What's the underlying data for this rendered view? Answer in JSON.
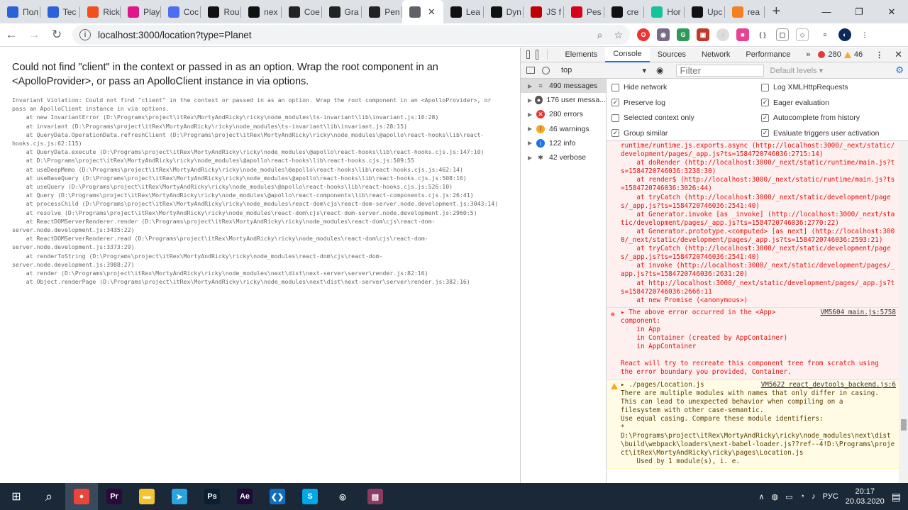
{
  "browser": {
    "tabs": [
      {
        "label": "Пол",
        "icon": "mail-icon",
        "color": "#2a62d8"
      },
      {
        "label": "Tec",
        "icon": "mail-icon",
        "color": "#2a62d8"
      },
      {
        "label": "Rick",
        "icon": "figma-icon",
        "color": "#f24e1e"
      },
      {
        "label": "Play",
        "icon": "figma-icon",
        "color": "#e0158a"
      },
      {
        "label": "Coc",
        "icon": "chat-icon",
        "color": "#4e6ef2"
      },
      {
        "label": "Rou",
        "icon": "next-icon",
        "color": "#111111"
      },
      {
        "label": "nex",
        "icon": "github-icon",
        "color": "#111111"
      },
      {
        "label": "Coe",
        "icon": "ch-icon",
        "color": "#222222"
      },
      {
        "label": "Gra",
        "icon": "ch-icon",
        "color": "#222222"
      },
      {
        "label": "Pen",
        "icon": "ch-icon",
        "color": "#222222"
      },
      {
        "label": "",
        "icon": "globe-icon",
        "color": "#5f6368",
        "active": true
      },
      {
        "label": "Lea",
        "icon": "next-icon",
        "color": "#111111"
      },
      {
        "label": "Dyn",
        "icon": "dev-icon",
        "color": "#111111"
      },
      {
        "label": "JS f",
        "icon": "heart-icon",
        "color": "#c00000"
      },
      {
        "label": "Pes",
        "icon": "hh-icon",
        "color": "#d6001c"
      },
      {
        "label": "cre",
        "icon": "github-icon",
        "color": "#111111"
      },
      {
        "label": "Hor",
        "icon": "grammarly-icon",
        "color": "#15c39a"
      },
      {
        "label": "Upc",
        "icon": "github-icon",
        "color": "#111111"
      },
      {
        "label": "rea",
        "icon": "stackoverflow-icon",
        "color": "#f48024"
      }
    ],
    "url": "localhost:3000/location?type=Planet"
  },
  "page": {
    "error_title": "Could not find \"client\" in the context or passed in as an option. Wrap the root component in an <ApolloProvider>, or pass an ApolloClient instance in via options.",
    "stack": "Invariant Violation: Could not find \"client\" in the context or passed in as an option. Wrap the root component in an <ApolloProvider>, or\npass an ApolloClient instance in via options.\n    at new InvariantError (D:\\Programs\\project\\itRex\\MortyAndRicky\\ricky\\node_modules\\ts-invariant\\lib\\invariant.js:16:28)\n    at invariant (D:\\Programs\\project\\itRex\\MortyAndRicky\\ricky\\node_modules\\ts-invariant\\lib\\invariant.js:28:15)\n    at QueryData.OperationData.refreshClient (D:\\Programs\\project\\itRex\\MortyAndRicky\\ricky\\node_modules\\@apollo\\react-hooks\\lib\\react-\nhooks.cjs.js:62:115)\n    at QueryData.execute (D:\\Programs\\project\\itRex\\MortyAndRicky\\ricky\\node_modules\\@apollo\\react-hooks\\lib\\react-hooks.cjs.js:147:10)\n    at D:\\Programs\\project\\itRex\\MortyAndRicky\\ricky\\node_modules\\@apollo\\react-hooks\\lib\\react-hooks.cjs.js:509:55\n    at useDeepMemo (D:\\Programs\\project\\itRex\\MortyAndRicky\\ricky\\node_modules\\@apollo\\react-hooks\\lib\\react-hooks.cjs.js:462:14)\n    at useBaseQuery (D:\\Programs\\project\\itRex\\MortyAndRicky\\ricky\\node_modules\\@apollo\\react-hooks\\lib\\react-hooks.cjs.js:508:16)\n    at useQuery (D:\\Programs\\project\\itRex\\MortyAndRicky\\ricky\\node_modules\\@apollo\\react-hooks\\lib\\react-hooks.cjs.js:526:10)\n    at Query (D:\\Programs\\project\\itRex\\MortyAndRicky\\ricky\\node_modules\\@apollo\\react-components\\lib\\react-components.cjs.js:26:41)\n    at processChild (D:\\Programs\\project\\itRex\\MortyAndRicky\\ricky\\node_modules\\react-dom\\cjs\\react-dom-server.node.development.js:3043:14)\n    at resolve (D:\\Programs\\project\\itRex\\MortyAndRicky\\ricky\\node_modules\\react-dom\\cjs\\react-dom-server.node.development.js:2960:5)\n    at ReactDOMServerRenderer.render (D:\\Programs\\project\\itRex\\MortyAndRicky\\ricky\\node_modules\\react-dom\\cjs\\react-dom-\nserver.node.development.js:3435:22)\n    at ReactDOMServerRenderer.read (D:\\Programs\\project\\itRex\\MortyAndRicky\\ricky\\node_modules\\react-dom\\cjs\\react-dom-\nserver.node.development.js:3373:29)\n    at renderToString (D:\\Programs\\project\\itRex\\MortyAndRicky\\ricky\\node_modules\\react-dom\\cjs\\react-dom-\nserver.node.development.js:3988:27)\n    at render (D:\\Programs\\project\\itRex\\MortyAndRicky\\ricky\\node_modules\\next\\dist\\next-server\\server\\render.js:82:16)\n    at Object.renderPage (D:\\Programs\\project\\itRex\\MortyAndRicky\\ricky\\node_modules\\next\\dist\\next-server\\server\\render.js:382:16)"
  },
  "devtools": {
    "tabs": [
      "Elements",
      "Console",
      "Sources",
      "Network",
      "Performance"
    ],
    "more": "»",
    "error_count": "280",
    "warning_count": "46",
    "context": "top",
    "filter_placeholder": "Filter",
    "levels": "Default levels ▾",
    "sidebar": [
      {
        "label": "490 messages",
        "icon": "list-icon"
      },
      {
        "label": "176 user messa...",
        "icon": "user-icon"
      },
      {
        "label": "280 errors",
        "icon": "error-icon"
      },
      {
        "label": "46 warnings",
        "icon": "warning-icon"
      },
      {
        "label": "122 info",
        "icon": "info-icon"
      },
      {
        "label": "42 verbose",
        "icon": "bug-icon"
      }
    ],
    "settings": [
      {
        "label": "Hide network",
        "checked": false
      },
      {
        "label": "Log XMLHttpRequests",
        "checked": false
      },
      {
        "label": "Preserve log",
        "checked": true
      },
      {
        "label": "Eager evaluation",
        "checked": true
      },
      {
        "label": "Selected context only",
        "checked": false
      },
      {
        "label": "Autocomplete from history",
        "checked": true
      },
      {
        "label": "Group similar",
        "checked": true
      },
      {
        "label": "Evaluate triggers user activation",
        "checked": true
      }
    ],
    "log": {
      "stack_lines": [
        "runtime/runtime.js.exports.async (http://localhost:3000/_next/static/development/pages/_app.js?ts=1584720746036:2715:14)",
        "    at doRender (http://localhost:3000/_next/static/runtime/main.js?ts=1584720746036:3238:30)",
        "    at render$ (http://localhost:3000/_next/static/runtime/main.js?ts=1584720746036:3026:44)",
        "    at tryCatch (http://localhost:3000/_next/static/development/pages/_app.js?ts=1584720746036:2541:40)",
        "    at Generator.invoke [as _invoke] (http://localhost:3000/_next/static/development/pages/_app.js?ts=1584720746036:2770:22)",
        "    at Generator.prototype.<computed> [as next] (http://localhost:3000/_next/static/development/pages/_app.js?ts=1584720746036:2593:21)",
        "    at tryCatch (http://localhost:3000/_next/static/development/pages/_app.js?ts=1584720746036:2541:40)",
        "    at invoke (http://localhost:3000/_next/static/development/pages/_app.js?ts=1584720746036:2631:20)",
        "    at http://localhost:3000/_next/static/development/pages/_app.js?ts=1584720746036:2666:11",
        "    at new Promise (<anonymous>)"
      ],
      "app_error_src": "VM5604 main.js:5758",
      "app_error_text": "▸ The above error occurred in the <App>\ncomponent:\n    in App\n    in Container (created by AppContainer)\n    in AppContainer\n\nReact will try to recreate this component tree from scratch using\nthe error boundary you provided, Container.",
      "warn_src": "VM5622 react_devtools_backend.js:6",
      "warn_text": "▸ ./pages/Location.js\nThere are multiple modules with names that only differ in casing.\nThis can lead to unexpected behavior when compiling on a\nfilesystem with other case-semantic.\nUse equal casing. Compare these module identifiers:\n*\nD:\\Programs\\project\\itRex\\MortyAndRicky\\ricky\\node_modules\\next\\dist\\build\\webpack\\loaders\\next-babel-loader.js??ref--4!D:\\Programs\\project\\itRex\\MortyAndRicky\\ricky\\pages\\Location.js\n    Used by 1 module(s), i. e."
    }
  },
  "taskbar": {
    "apps": [
      {
        "name": "chrome-icon",
        "color": "#e8453c",
        "glyph": "●",
        "active": true
      },
      {
        "name": "premiere-icon",
        "color": "#2a0a3a",
        "glyph": "Pr"
      },
      {
        "name": "folder-icon",
        "color": "#f4c430",
        "glyph": "▬"
      },
      {
        "name": "telegram-icon",
        "color": "#2aa3e0",
        "glyph": "➤"
      },
      {
        "name": "photoshop-icon",
        "color": "#0b1f33",
        "glyph": "Ps"
      },
      {
        "name": "aftereffects-icon",
        "color": "#1f0a3a",
        "glyph": "Ae"
      },
      {
        "name": "vscode-icon",
        "color": "#0e6fc0",
        "glyph": "❮❯"
      },
      {
        "name": "skype-icon",
        "color": "#00a8e8",
        "glyph": "S"
      },
      {
        "name": "steam-icon",
        "color": "#1b2838",
        "glyph": "◎"
      },
      {
        "name": "winrar-icon",
        "color": "#8b3a62",
        "glyph": "▤"
      }
    ],
    "lang": "РУС",
    "time": "20:17",
    "date": "20.03.2020"
  }
}
